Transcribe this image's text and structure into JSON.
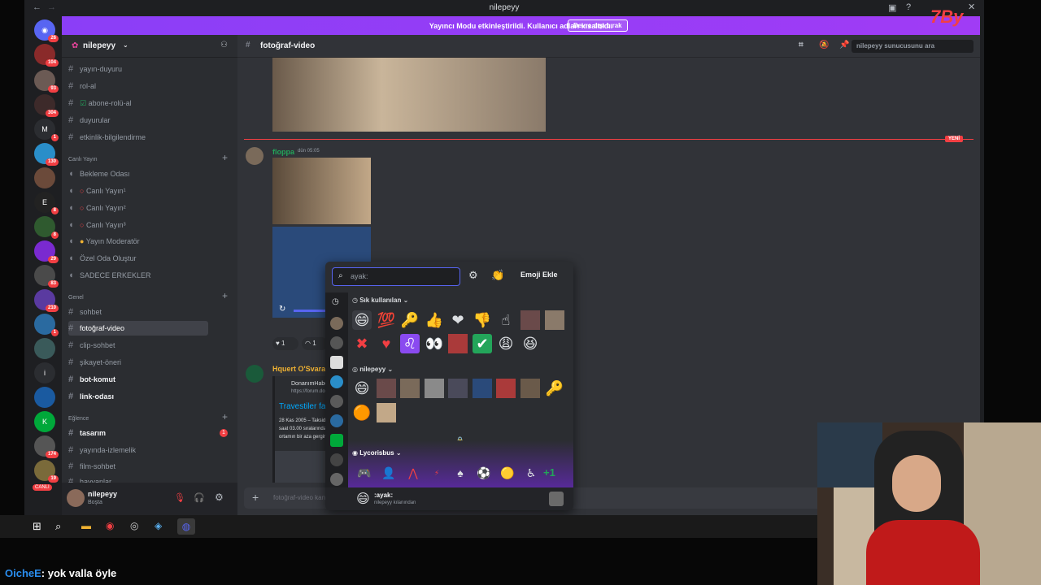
{
  "window": {
    "title": "nilepeyy"
  },
  "banner": {
    "text": "Yayıncı Modu etkinleştirildi. Kullanıcı adları kısaltıldı.",
    "button": "Devre dışı bırak"
  },
  "rail": {
    "badges": [
      "26",
      "104",
      "93",
      "304",
      "1",
      "130",
      "8",
      "8",
      "29",
      "83",
      "210",
      "1",
      "174",
      "19"
    ],
    "letters": [
      "M",
      "E",
      "i",
      "K"
    ],
    "live": "CANLI"
  },
  "sidebar": {
    "server_name": "nilepeyy",
    "channels": [
      "yayın-duyuru",
      "rol-al",
      "abone-rolü-al",
      "duyurular",
      "etkinlik-bilgilendirme"
    ],
    "categories": [
      "Canlı Yayın",
      "Genel",
      "Eğlence"
    ],
    "voice": [
      "Bekleme Odası",
      "Canlı Yayın¹",
      "Canlı Yayın²",
      "Canlı Yayın³",
      "Yayın Moderatör",
      "Özel Oda Oluştur",
      "SADECE ERKEKLER"
    ],
    "general": [
      "sohbet",
      "fotoğraf-video",
      "clip-sohbet",
      "şikayet-öneri",
      "bot-komut",
      "link-odası"
    ],
    "fun": [
      "tasarım",
      "yayında-izlemelik",
      "film-sohbet",
      "hayvanlar"
    ],
    "fun_badge": "1"
  },
  "user": {
    "name": "nilepeyy",
    "status": "Boşta"
  },
  "main": {
    "channel_title": "fotoğraf-video",
    "search_placeholder": "nilepeyy sunucusunu ara",
    "new_label": "YENİ",
    "msg1": {
      "author": "floppa",
      "time": "dün 05:05"
    },
    "reactions": [
      "1",
      "1"
    ],
    "msg2": {
      "author": "Hquert O'Svara",
      "embed_site": "DonanımHaber Fo...",
      "embed_url": "https://forum.donani...",
      "embed_title": "Travestiler fakülte...",
      "embed_line1": "28 Kas 2005 – Takside...",
      "embed_line2": "saat 03.00 sıralarında G...",
      "embed_line3": "ortamın bir aza gerginleş..."
    },
    "composer_placeholder": "fotoğraf-video kanalına mesaj gönder"
  },
  "picker": {
    "search_placeholder": "ayak:",
    "add_button": "Emoji Ekle",
    "sections": [
      "Sık kullanılan",
      "nilepeyy",
      "Lycorisbus"
    ],
    "more_count": "+1",
    "preview_name": ":ayak:",
    "preview_source": "nilepeyy kılanından"
  },
  "overlay": {
    "logo": "7By"
  },
  "chat": {
    "user": "OicheE",
    "text": ": yok valla öyle"
  }
}
